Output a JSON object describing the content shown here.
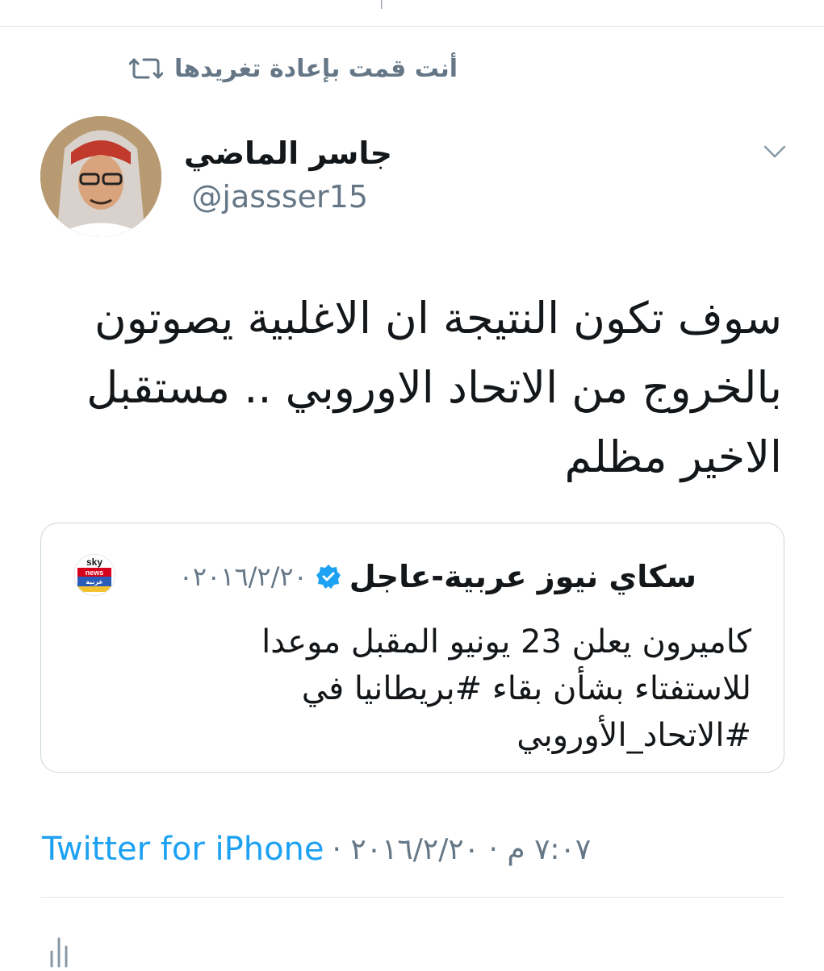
{
  "top_partial": "|",
  "retweet": {
    "text": "أنت قمت بإعادة تغريدها",
    "icon": "retweet-icon"
  },
  "author": {
    "name": "جاسر الماضي",
    "handle": "@jassser15",
    "avatar_icon": "avatar"
  },
  "tweet": {
    "lines": [
      "سوف تكون النتيجة ان الاغلبية يصوتون",
      "بالخروج من الاتحاد الاوروبي .. مستقبل",
      "الاخير مظلم"
    ]
  },
  "quoted": {
    "name": "سكاي نيوز عربية-عاجل",
    "date": "٠٢٠١٦/٢/٢٠",
    "verified_icon": "verified-badge-icon",
    "logo_icon": "sky-news-logo-icon",
    "logo_text": {
      "sky": "sky",
      "news": "news",
      "arabic": "عربية"
    },
    "lines": [
      "كاميرون يعلن 23 يونيو المقبل موعدا",
      "للاستفتاء بشأن بقاء #بريطانيا في",
      "#الاتحاد_الأوروبي"
    ]
  },
  "meta": {
    "source": "Twitter for iPhone",
    "datetime": "٧:٠٧ م · ٢٠١٦/٢/٢٠ ·"
  },
  "colors": {
    "link_blue": "#1da1f2",
    "muted_gray": "#657786",
    "divider": "#e1e8ed"
  }
}
